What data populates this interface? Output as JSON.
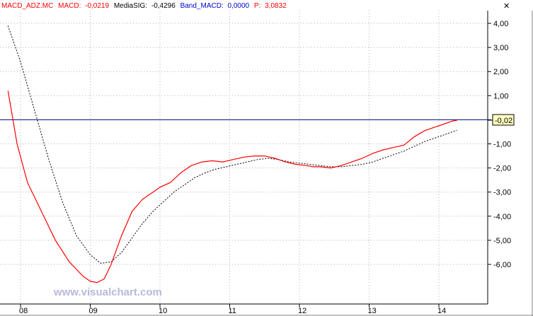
{
  "header": {
    "series_label": "MACD_ADZ.MC",
    "macd_label": "MACD:",
    "macd_value": "-0,0219",
    "signal_label": "MediaSIG:",
    "signal_value": "-0,4296",
    "band_label": "Band_MACD:",
    "band_value": "0,0000",
    "p_label": "P:",
    "p_value": "3,0832"
  },
  "close_icon_glyph": "✕",
  "watermark": "www.visualchart.com",
  "current_value_label": "-0,02",
  "colors": {
    "macd": "#ff0000",
    "signal": "#000000",
    "band": "#000080",
    "grid": "#b0b0b0",
    "label_bg": "#ffffc0",
    "watermark": "#b8b8dc",
    "header_series": "#ff0000",
    "header_macd": "#ff0000",
    "header_signal": "#000000",
    "header_band": "#0000cc",
    "header_p": "#ff0000"
  },
  "chart_data": {
    "type": "line",
    "ylim": [
      -7.0,
      4.2
    ],
    "y_ticks": [
      4,
      3,
      2,
      1,
      0,
      -1,
      -2,
      -3,
      -4,
      -5,
      -6
    ],
    "y_tick_labels": [
      "4,00",
      "3,00",
      "2,00",
      "1,00",
      "",
      "-1,00",
      "-2,00",
      "-3,00",
      "-4,00",
      "-5,00",
      "-6,00"
    ],
    "x_range": [
      2007.8,
      2014.85
    ],
    "x_ticks": [
      2008,
      2009,
      2010,
      2011,
      2012,
      2013,
      2014
    ],
    "x_tick_labels": [
      "08",
      "09",
      "10",
      "11",
      "12",
      "13",
      "14"
    ],
    "grid": true,
    "band_line": 0.0,
    "series": [
      {
        "name": "MACD",
        "style": "solid",
        "x": [
          2007.82,
          2007.95,
          2008.1,
          2008.3,
          2008.5,
          2008.7,
          2008.9,
          2009.0,
          2009.1,
          2009.2,
          2009.3,
          2009.45,
          2009.6,
          2009.75,
          2009.9,
          2010.0,
          2010.15,
          2010.3,
          2010.45,
          2010.6,
          2010.75,
          2010.9,
          2011.05,
          2011.2,
          2011.35,
          2011.5,
          2011.65,
          2011.8,
          2011.95,
          2012.1,
          2012.2,
          2012.3,
          2012.45,
          2012.6,
          2012.75,
          2012.9,
          2013.05,
          2013.2,
          2013.35,
          2013.5,
          2013.65,
          2013.8,
          2013.95,
          2014.1,
          2014.2,
          2014.26
        ],
        "values": [
          1.2,
          -1.0,
          -2.6,
          -3.8,
          -5.0,
          -5.9,
          -6.5,
          -6.7,
          -6.75,
          -6.6,
          -6.0,
          -4.8,
          -3.8,
          -3.3,
          -3.0,
          -2.8,
          -2.6,
          -2.2,
          -1.9,
          -1.75,
          -1.7,
          -1.75,
          -1.65,
          -1.55,
          -1.5,
          -1.5,
          -1.6,
          -1.75,
          -1.85,
          -1.9,
          -1.95,
          -1.95,
          -2.0,
          -1.9,
          -1.75,
          -1.6,
          -1.4,
          -1.25,
          -1.15,
          -1.05,
          -0.7,
          -0.45,
          -0.3,
          -0.15,
          -0.05,
          -0.02
        ]
      },
      {
        "name": "MediaSIG",
        "style": "dashed",
        "x": [
          2007.82,
          2008.0,
          2008.2,
          2008.4,
          2008.6,
          2008.8,
          2009.0,
          2009.15,
          2009.3,
          2009.45,
          2009.6,
          2009.75,
          2009.9,
          2010.05,
          2010.2,
          2010.35,
          2010.5,
          2010.65,
          2010.8,
          2010.95,
          2011.1,
          2011.25,
          2011.4,
          2011.55,
          2011.7,
          2011.85,
          2012.0,
          2012.15,
          2012.3,
          2012.45,
          2012.6,
          2012.75,
          2012.9,
          2013.05,
          2013.2,
          2013.35,
          2013.5,
          2013.65,
          2013.8,
          2013.95,
          2014.1,
          2014.26
        ],
        "values": [
          3.9,
          2.4,
          0.4,
          -1.6,
          -3.4,
          -4.8,
          -5.6,
          -5.95,
          -5.9,
          -5.5,
          -4.9,
          -4.3,
          -3.8,
          -3.4,
          -3.0,
          -2.7,
          -2.4,
          -2.2,
          -2.05,
          -1.95,
          -1.85,
          -1.75,
          -1.65,
          -1.6,
          -1.65,
          -1.75,
          -1.8,
          -1.85,
          -1.9,
          -1.95,
          -1.95,
          -1.9,
          -1.85,
          -1.75,
          -1.6,
          -1.45,
          -1.3,
          -1.1,
          -0.9,
          -0.75,
          -0.6,
          -0.43
        ]
      }
    ]
  }
}
